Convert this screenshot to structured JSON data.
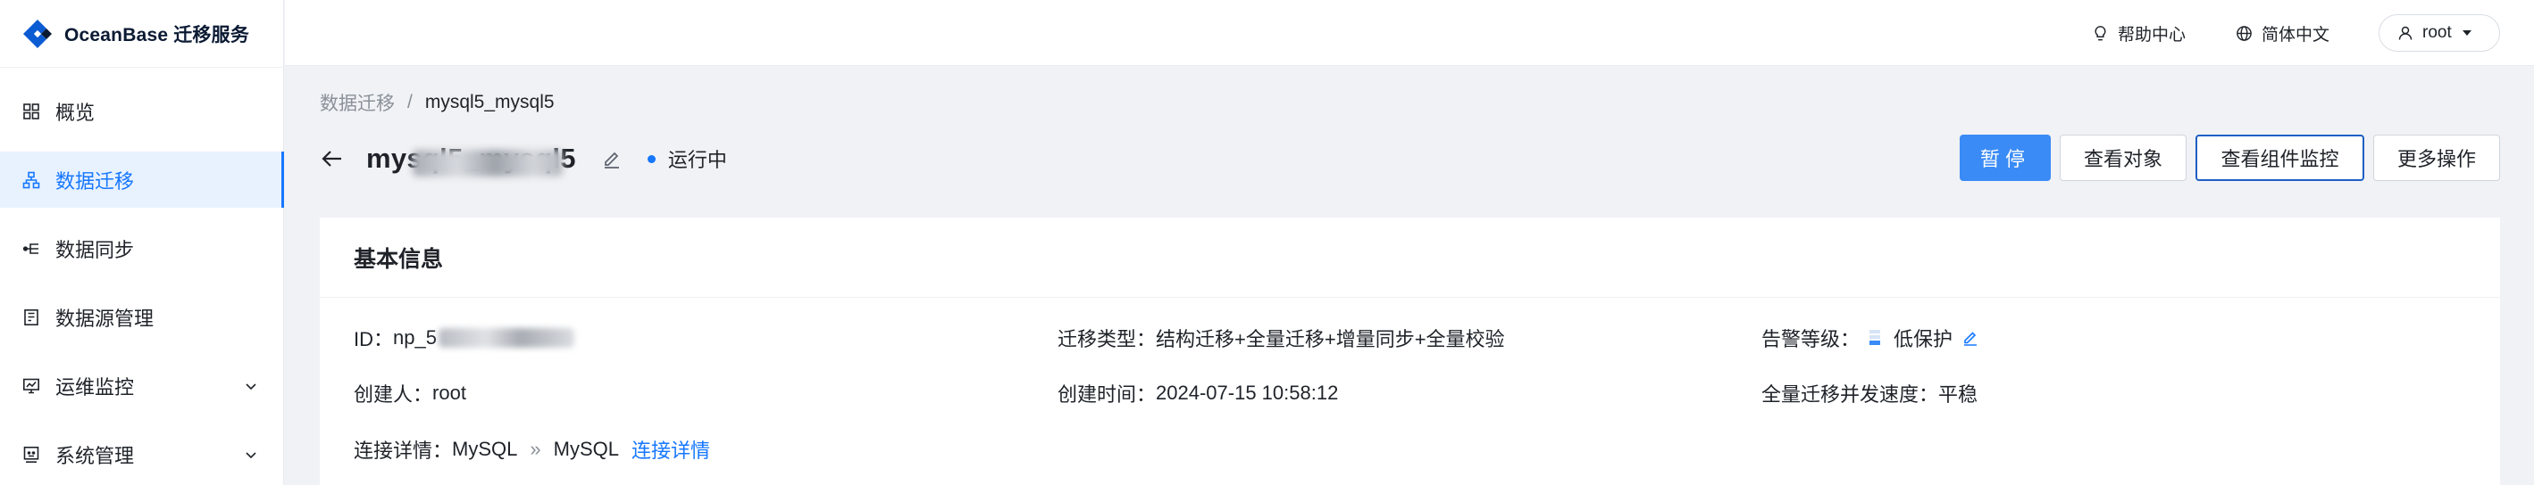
{
  "app": {
    "logo_text": "OceanBase 迁移服务"
  },
  "sidebar": {
    "items": [
      {
        "label": "概览",
        "icon": "dashboard-grid-icon",
        "active": false,
        "expandable": false
      },
      {
        "label": "数据迁移",
        "icon": "org-tree-icon",
        "active": true,
        "expandable": false
      },
      {
        "label": "数据同步",
        "icon": "sync-branch-icon",
        "active": false,
        "expandable": false
      },
      {
        "label": "数据源管理",
        "icon": "datasource-book-icon",
        "active": false,
        "expandable": false
      },
      {
        "label": "运维监控",
        "icon": "monitor-screen-icon",
        "active": false,
        "expandable": true
      },
      {
        "label": "系统管理",
        "icon": "system-settings-icon",
        "active": false,
        "expandable": true
      }
    ]
  },
  "topbar": {
    "help_label": "帮助中心",
    "language_label": "简体中文",
    "user_label": "root"
  },
  "breadcrumb": {
    "parent": "数据迁移",
    "separator": "/",
    "current": "mysql5_mysql5"
  },
  "task": {
    "title": "mysql5_mysql5",
    "status": "运行中",
    "status_color": "#1677ff"
  },
  "actions": {
    "pause": "暂停",
    "view_objects": "查看对象",
    "view_component_monitor": "查看组件监控",
    "more_actions": "更多操作"
  },
  "basic_info": {
    "heading": "基本信息",
    "id_label": "ID：",
    "id_value": "np_5",
    "migration_type_label": "迁移类型：",
    "migration_type_value": "结构迁移+全量迁移+增量同步+全量校验",
    "alarm_level_label": "告警等级：",
    "alarm_level_value": "低保护",
    "creator_label": "创建人：",
    "creator_value": "root",
    "created_time_label": "创建时间：",
    "created_time_value": "2024-07-15 10:58:12",
    "full_migration_speed_label": "全量迁移并发速度：",
    "full_migration_speed_value": "平稳",
    "connection_label": "连接详情：",
    "source_db": "MySQL",
    "connection_arrow": "»",
    "target_db": "MySQL",
    "connection_link": "连接详情"
  },
  "colors": {
    "primary": "#1677ff",
    "primary_button": "#3a8bf5",
    "active_nav_bg": "#e8f2ff",
    "page_bg": "#f0f2f5"
  }
}
